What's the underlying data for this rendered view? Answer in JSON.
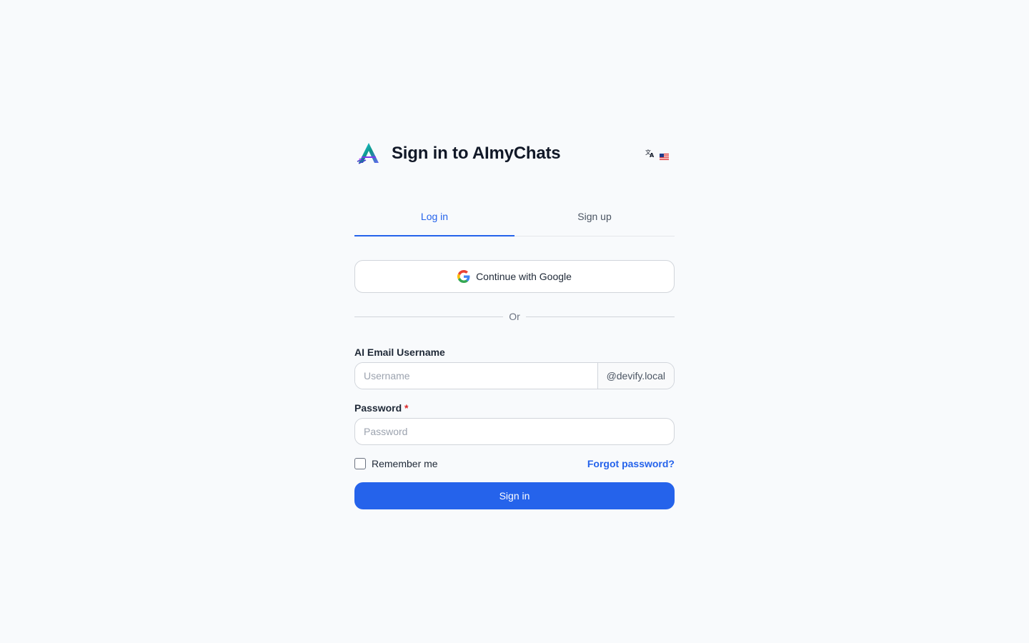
{
  "header": {
    "title": "Sign in to AImyChats",
    "logo_icon": "aimychats-logo-icon",
    "language_icon": "translate-icon",
    "flag_icon": "us-flag-icon"
  },
  "tabs": [
    {
      "label": "Log in",
      "active": true
    },
    {
      "label": "Sign up",
      "active": false
    }
  ],
  "google": {
    "label": "Continue with Google",
    "icon": "google-icon"
  },
  "divider": {
    "label": "Or"
  },
  "email": {
    "label": "AI Email Username",
    "placeholder": "Username",
    "value": "",
    "suffix": "@devify.local"
  },
  "password": {
    "label": "Password",
    "required_mark": "*",
    "placeholder": "Password",
    "value": ""
  },
  "remember": {
    "label": "Remember me",
    "checked": false
  },
  "forgot": {
    "label": "Forgot password?"
  },
  "submit": {
    "label": "Sign in"
  },
  "colors": {
    "accent": "#2563eb",
    "background": "#f8fafc",
    "required": "#dc2626"
  }
}
